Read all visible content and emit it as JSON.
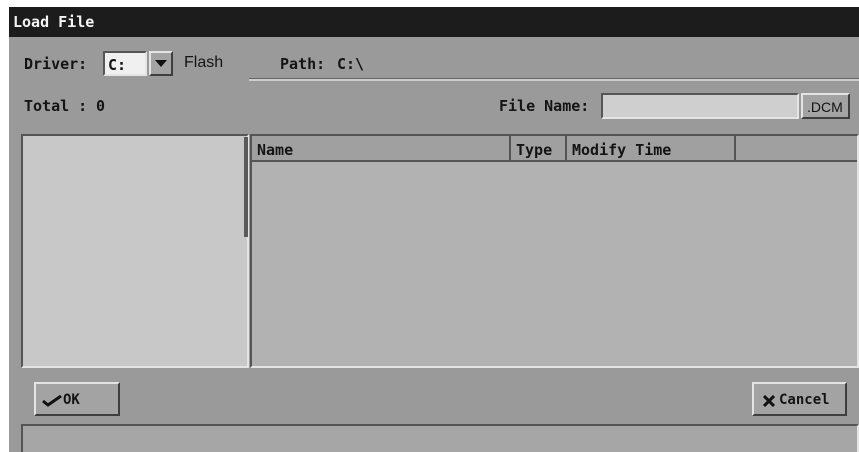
{
  "window": {
    "title": "Load File"
  },
  "driver": {
    "label": "Driver:",
    "value": "C:",
    "name": "Flash"
  },
  "path": {
    "label": "Path:",
    "value": "C:\\"
  },
  "total": {
    "label": "Total :",
    "value": "0"
  },
  "file_name": {
    "label": "File Name:",
    "value": "",
    "extension": ".DCM"
  },
  "file_table": {
    "columns": [
      "Name",
      "Type",
      "Modify Time",
      ""
    ],
    "rows": []
  },
  "buttons": {
    "ok": "OK",
    "cancel": "Cancel"
  },
  "status": {
    "text": ""
  },
  "icons": {
    "dropdown": "chevron-down-icon",
    "ok": "checkmark-icon",
    "cancel": "x-icon"
  }
}
